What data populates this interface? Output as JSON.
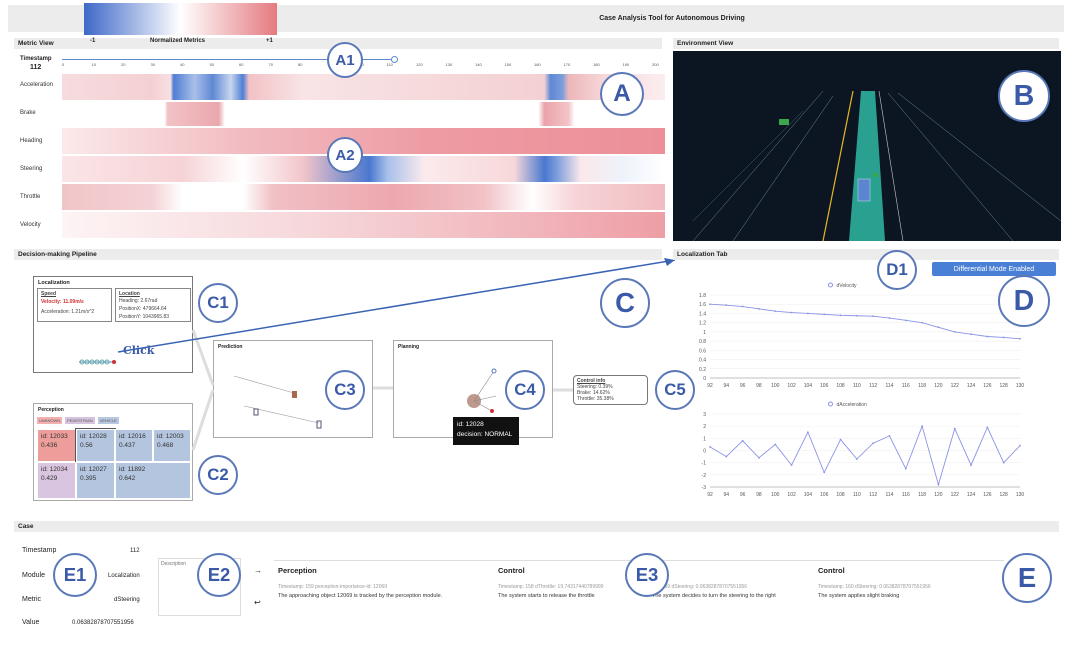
{
  "header": {
    "title": "Case Analysis Tool for Autonomous Driving",
    "legend_min": "-1",
    "legend_label": "Normalized Metrics",
    "legend_max": "+1"
  },
  "metric_view": {
    "title": "Metric View",
    "timestamp_label": "Timestamp",
    "timestamp_value": "112",
    "axis_ticks": [
      "0",
      "10",
      "20",
      "30",
      "40",
      "50",
      "60",
      "70",
      "80",
      "90",
      "100",
      "110",
      "120",
      "130",
      "140",
      "150",
      "160",
      "170",
      "180",
      "190",
      "200"
    ],
    "metrics": [
      "Acceleration",
      "Brake",
      "Heading",
      "Steering",
      "Throttle",
      "Velocity"
    ]
  },
  "environment_view": {
    "title": "Environment View"
  },
  "pipeline": {
    "title": "Decision-making Pipeline",
    "localization": {
      "title": "Localization",
      "speed_title": "Speed",
      "velocity": "Velocity: 11.09m/s",
      "acceleration": "Acceleration: 1.21m/s^2",
      "location_title": "Location",
      "heading": "Heading: 2.67rad",
      "position_x": "PositionX: 479664.64",
      "position_y": "PositionY: 1043965.83",
      "click": "Click"
    },
    "perception": {
      "title": "Perception",
      "legend": [
        "UNKNOWN",
        "PEDESTRIAN",
        "VEHICLE"
      ],
      "cells": [
        {
          "id": "id: 12033",
          "val": "0.436"
        },
        {
          "id": "id: 12028",
          "val": "0.56"
        },
        {
          "id": "id: 12016",
          "val": "0.437"
        },
        {
          "id": "id: 12003",
          "val": "0.468"
        },
        {
          "id": "id: 12034",
          "val": "0.429"
        },
        {
          "id": "id: 12027",
          "val": "0.395"
        },
        {
          "id": "id: 11892",
          "val": "0.642"
        }
      ]
    },
    "prediction": {
      "title": "Prediction"
    },
    "planning": {
      "title": "Planning",
      "tooltip_id": "id: 12028",
      "tooltip_decision": "decision: NORMAL"
    },
    "control": {
      "title": "Control info",
      "steering": "Steering: 0.39%",
      "brake": "Brake: 14.62%",
      "throttle": "Throttle: 35.38%"
    }
  },
  "localization_tab": {
    "title": "Localization Tab",
    "mode_button": "Differential Mode Enabled",
    "chart1_legend": "dVelocity",
    "chart2_legend": "dAcceleration",
    "chart1_yticks": [
      "1.8",
      "1.6",
      "1.4",
      "1.2",
      "1",
      "0.8",
      "0.6",
      "0.4",
      "0.2",
      "0"
    ],
    "chart2_yticks": [
      "3",
      "2",
      "1",
      "0",
      "-1",
      "-2",
      "-3"
    ],
    "xticks": [
      "92",
      "94",
      "96",
      "98",
      "100",
      "102",
      "104",
      "106",
      "108",
      "110",
      "112",
      "114",
      "116",
      "118",
      "120",
      "122",
      "124",
      "126",
      "128",
      "130"
    ]
  },
  "chart_data": [
    {
      "type": "line",
      "title": "",
      "series": [
        {
          "name": "dVelocity",
          "values": [
            1.6,
            1.58,
            1.55,
            1.5,
            1.45,
            1.42,
            1.4,
            1.38,
            1.36,
            1.35,
            1.34,
            1.3,
            1.25,
            1.2,
            1.1,
            1.0,
            0.95,
            0.9,
            0.88,
            0.85
          ]
        }
      ],
      "x": [
        92,
        94,
        96,
        98,
        100,
        102,
        104,
        106,
        108,
        110,
        112,
        114,
        116,
        118,
        120,
        122,
        124,
        126,
        128,
        130
      ],
      "ylim": [
        0,
        1.8
      ]
    },
    {
      "type": "line",
      "title": "",
      "series": [
        {
          "name": "dAcceleration",
          "values": [
            0.3,
            -0.5,
            0.8,
            -0.6,
            0.5,
            -1.2,
            1.5,
            -1.8,
            0.9,
            -0.7,
            0.6,
            1.2,
            -1.5,
            2.0,
            -2.8,
            1.8,
            -1.2,
            1.9,
            -1.0,
            0.4
          ]
        }
      ],
      "x": [
        92,
        94,
        96,
        98,
        100,
        102,
        104,
        106,
        108,
        110,
        112,
        114,
        116,
        118,
        120,
        122,
        124,
        126,
        128,
        130
      ],
      "ylim": [
        -3,
        3
      ]
    }
  ],
  "case": {
    "title": "Case",
    "timestamp_label": "Timestamp",
    "timestamp_value": "112",
    "module_label": "Module",
    "module_value": "Localization",
    "metric_label": "Metric",
    "metric_value": "dSteering",
    "value_label": "Value",
    "value_value": "0.06382878707551956",
    "description_placeholder": "Description",
    "events": [
      {
        "module": "Perception",
        "meta": "Timestamp: 159 perception-importance-id: 12069",
        "text": "The approaching object 12069 is tracked by the perception module."
      },
      {
        "module": "Control",
        "meta": "Timestamp: 158 dThrottle: 19.74317440789999",
        "text": "The system starts to release the throttle"
      },
      {
        "module": "",
        "meta": "mp: 159 dSteering: 0.06382878707551956",
        "text": "The system decides to turn the steering to the right"
      },
      {
        "module": "Control",
        "meta": "Timestamp: 160 dSteering: 0.06382878707551956",
        "text": "The system applies slight braking"
      }
    ]
  },
  "badges": {
    "A": "A",
    "A1": "A1",
    "A2": "A2",
    "B": "B",
    "C": "C",
    "C1": "C1",
    "C2": "C2",
    "C3": "C3",
    "C4": "C4",
    "C5": "C5",
    "D": "D",
    "D1": "D1",
    "E": "E",
    "E1": "E1",
    "E2": "E2",
    "E3": "E3"
  },
  "colors": {
    "blue": "#4a72c4",
    "red": "#e88a93",
    "accent": "#4a7fd6"
  }
}
